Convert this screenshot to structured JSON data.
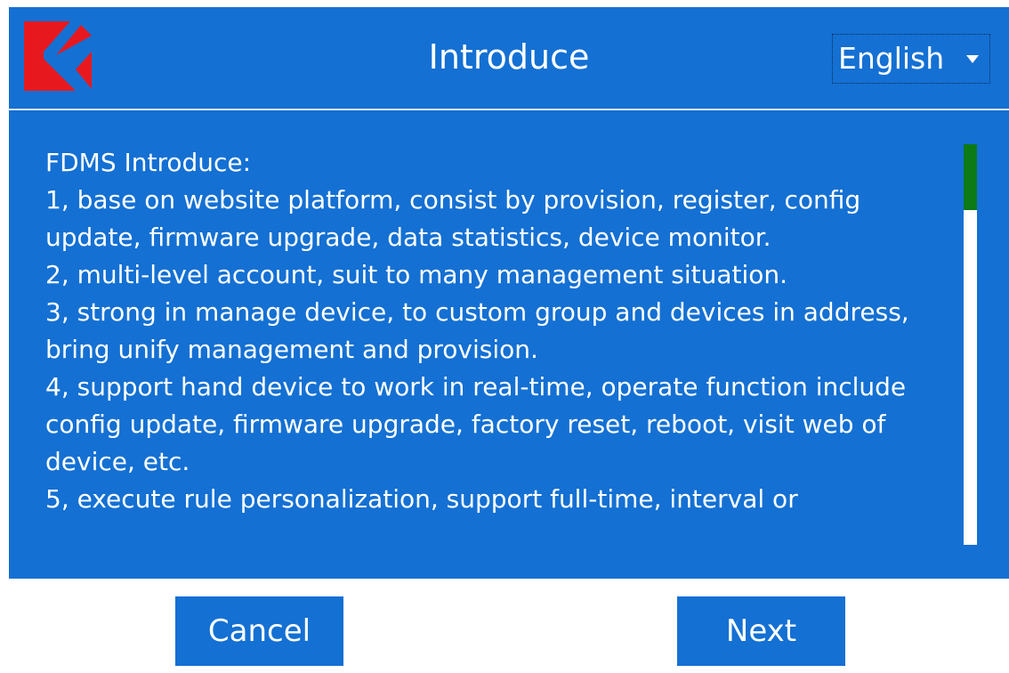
{
  "window": {
    "title": "Introduce",
    "language": {
      "selected": "English"
    }
  },
  "logo": {
    "name": "brand-logo",
    "colors": {
      "primary": "#e8191e"
    }
  },
  "content": {
    "lines": [
      "FDMS Introduce:",
      "1, base on website platform, consist by provision, register, config update, firmware upgrade, data statistics, device monitor.",
      "2, multi-level account, suit to many management situation.",
      "3, strong in manage device, to custom group and devices in address, bring unify management and provision.",
      "4, support hand device to work in real-time, operate function include config update, firmware upgrade, factory reset, reboot, visit web of device, etc.",
      "5, execute rule personalization, support full-time, interval or"
    ],
    "scroll_position": 0
  },
  "buttons": {
    "cancel": "Cancel",
    "next": "Next"
  },
  "colors": {
    "accent": "#1470d3",
    "scroll_thumb": "#0c7a16",
    "text": "#ffffff"
  }
}
